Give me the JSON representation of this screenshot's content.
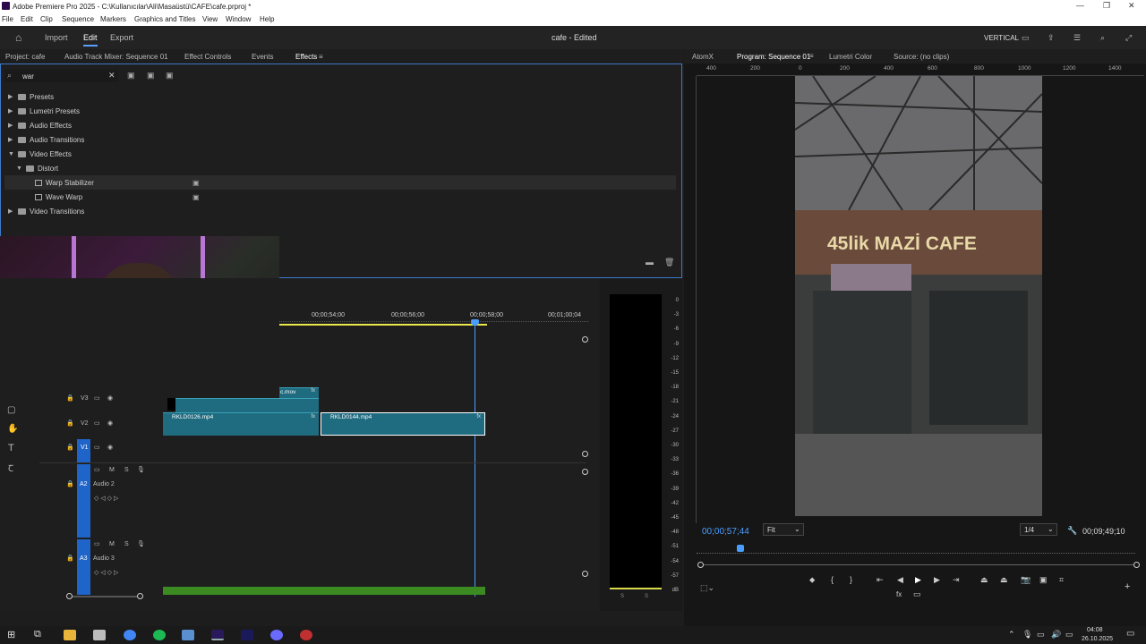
{
  "window": {
    "title": "Adobe Premiere Pro 2025 - C:\\Kullanıcılar\\Ali\\Masaüstü\\CAFE\\cafe.prproj *"
  },
  "menu": [
    "File",
    "Edit",
    "Clip",
    "Sequence",
    "Markers",
    "Graphics and Titles",
    "View",
    "Window",
    "Help"
  ],
  "header": {
    "nav": [
      "Import",
      "Edit",
      "Export"
    ],
    "project_status": "cafe - Edited",
    "layout_mode": "VERTICAL"
  },
  "left_panel": {
    "tabs": [
      "Project: cafe",
      "Audio Track Mixer: Sequence 01",
      "Effect Controls",
      "Events",
      "Effects"
    ],
    "search_value": "war",
    "tree": [
      {
        "label": "Presets",
        "level": 0,
        "kind": "folder",
        "expanded": false
      },
      {
        "label": "Lumetri Presets",
        "level": 0,
        "kind": "folder",
        "expanded": false
      },
      {
        "label": "Audio Effects",
        "level": 0,
        "kind": "folder",
        "expanded": false
      },
      {
        "label": "Audio Transitions",
        "level": 0,
        "kind": "folder",
        "expanded": false
      },
      {
        "label": "Video Effects",
        "level": 0,
        "kind": "folder",
        "expanded": true
      },
      {
        "label": "Distort",
        "level": 1,
        "kind": "folder",
        "expanded": true
      },
      {
        "label": "Warp Stabilizer",
        "level": 2,
        "kind": "effect"
      },
      {
        "label": "Wave Warp",
        "level": 2,
        "kind": "effect"
      },
      {
        "label": "Video Transitions",
        "level": 0,
        "kind": "folder",
        "expanded": false
      }
    ]
  },
  "timeline": {
    "ruler_labels": [
      "00;00;54;00",
      "00;00;56;00",
      "00;00;58;00",
      "00;01;00;04"
    ],
    "tracks": [
      {
        "id": "V3",
        "label": "V3"
      },
      {
        "id": "V2",
        "label": "V2"
      },
      {
        "id": "V1",
        "label": "V1"
      },
      {
        "id": "A2",
        "label": "A2",
        "name": "Audio 2"
      },
      {
        "id": "A3",
        "label": "A3",
        "name": "Audio 3"
      }
    ],
    "track_buttons": [
      "M",
      "S"
    ],
    "clips": [
      {
        "name": "c.mov",
        "track": "V3"
      },
      {
        "name": "RKLD0126.mp4",
        "track": "V2"
      },
      {
        "name": "RKLD0144.mp4",
        "track": "V2"
      }
    ]
  },
  "meter": {
    "labels": [
      "0",
      "-3",
      "-6",
      "-9",
      "-12",
      "-15",
      "-18",
      "-21",
      "-24",
      "-27",
      "-30",
      "-33",
      "-36",
      "-39",
      "-42",
      "-45",
      "-48",
      "-51",
      "-54",
      "-57",
      "dB"
    ],
    "bottom": [
      "S",
      "S"
    ]
  },
  "program": {
    "tabs": [
      "AtomX",
      "Program: Sequence 01",
      "Lumetri Color",
      "Source: (no clips)"
    ],
    "ruler_labels": [
      "400",
      "200",
      "0",
      "200",
      "400",
      "600",
      "800",
      "1000",
      "1200",
      "1400"
    ],
    "timecode": "00;00;57;44",
    "zoom": "Fit",
    "resolution": "1/4",
    "duration": "00;09;49;10",
    "sign_text": "45lik MAZİ CAFE"
  },
  "taskbar": {
    "time": "04:08",
    "date": "26.10.2025"
  },
  "colors": {
    "accent": "#5aa0ff",
    "clip": "#1f6b80",
    "audio_clip": "#3b8a22",
    "track_target": "#1f64c8"
  }
}
